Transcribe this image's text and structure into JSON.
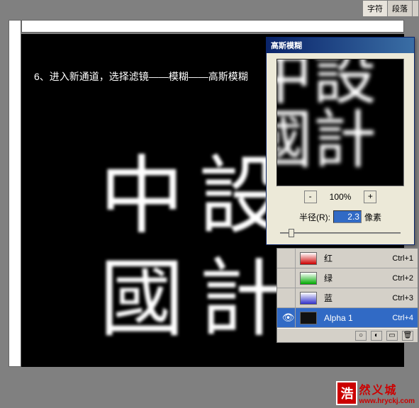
{
  "tabs": {
    "char": "字符",
    "para": "段落"
  },
  "canvas": {
    "instruction": "6、进入新通道，选择滤镜——模糊——高斯模糊",
    "chars": [
      "中",
      "設",
      "國",
      "計"
    ]
  },
  "dialog": {
    "title": "高斯模糊",
    "zoom_minus": "-",
    "zoom_plus": "+",
    "zoom": "100%",
    "radius_label": "半径(R):",
    "radius_value": "2.3",
    "radius_unit": "像素"
  },
  "channels": [
    {
      "name": "红",
      "shortcut": "Ctrl+1",
      "thumb": "red",
      "eye": ""
    },
    {
      "name": "绿",
      "shortcut": "Ctrl+2",
      "thumb": "green",
      "eye": ""
    },
    {
      "name": "蓝",
      "shortcut": "Ctrl+3",
      "thumb": "blue",
      "eye": ""
    },
    {
      "name": "Alpha 1",
      "shortcut": "Ctrl+4",
      "thumb": "alpha",
      "eye": "👁",
      "selected": true
    }
  ],
  "watermark": {
    "badge": "浩",
    "text": "然义城",
    "url": "www.hryckj.com"
  }
}
